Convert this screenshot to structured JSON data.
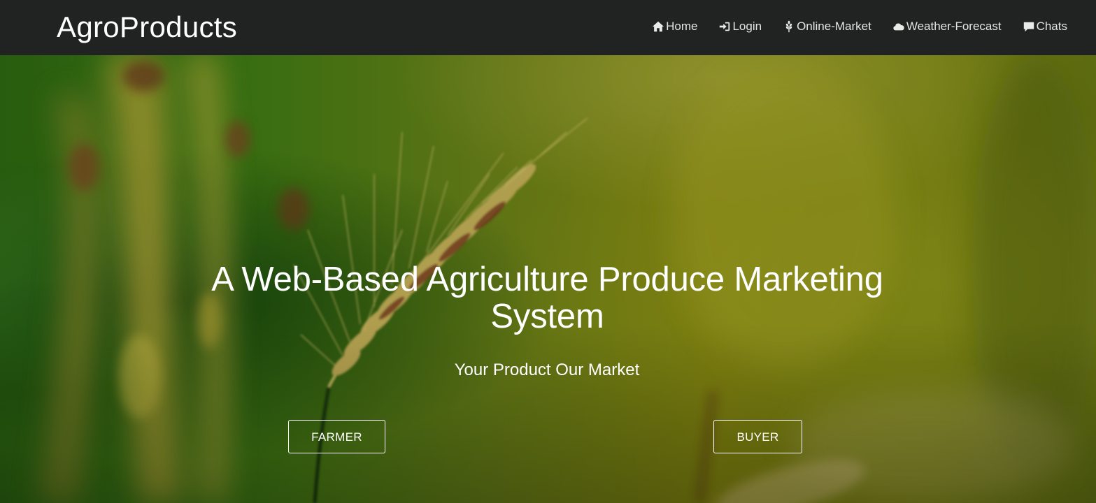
{
  "navbar": {
    "brand": "AgroProducts",
    "items": [
      {
        "label": "Home",
        "icon": "home-icon"
      },
      {
        "label": "Login",
        "icon": "login-icon"
      },
      {
        "label": "Online-Market",
        "icon": "grain-icon"
      },
      {
        "label": "Weather-Forecast",
        "icon": "cloud-icon"
      },
      {
        "label": "Chats",
        "icon": "chat-icon"
      }
    ]
  },
  "hero": {
    "headline": "A Web-Based Agriculture Produce Marketing System",
    "tagline": "Your Product Our Market",
    "buttons": {
      "farmer": "FARMER",
      "buyer": "BUYER"
    }
  },
  "colors": {
    "navbar_bg": "#212322",
    "nav_text": "#e4e6e4",
    "hero_text": "#ffffff",
    "hero_green": "#4a7a12",
    "hero_yellow": "#8f8a10"
  }
}
